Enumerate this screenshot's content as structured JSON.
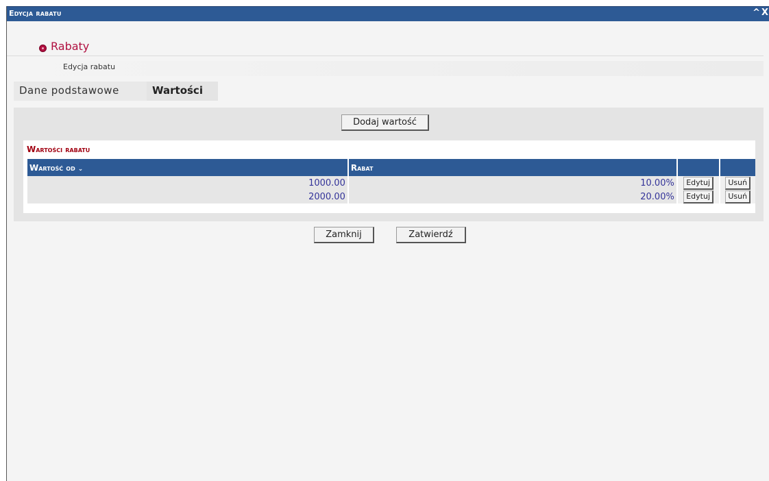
{
  "window": {
    "title": "Edycja rabatu",
    "minimize_glyph": "^",
    "close_glyph": "X"
  },
  "header": {
    "section_title": "Rabaty",
    "subtitle": "Edycja rabatu"
  },
  "tabs": [
    {
      "label": "Dane podstawowe",
      "active": false
    },
    {
      "label": "Wartości",
      "active": true
    }
  ],
  "panel": {
    "add_value_label": "Dodaj wartość",
    "grid_title": "Wartości rabatu",
    "columns": [
      {
        "label": "Wartość od",
        "sort_icon": "sort-desc-icon"
      },
      {
        "label": "Rabat"
      },
      {
        "label": ""
      },
      {
        "label": ""
      }
    ],
    "rows": [
      {
        "value_from": "1000.00",
        "discount": "10.00%",
        "edit_label": "Edytuj",
        "delete_label": "Usuń"
      },
      {
        "value_from": "2000.00",
        "discount": "20.00%",
        "edit_label": "Edytuj",
        "delete_label": "Usuń"
      }
    ]
  },
  "footer": {
    "close_label": "Zamknij",
    "confirm_label": "Zatwierdź"
  },
  "colors": {
    "titlebar": "#2d5a95",
    "accent_red": "#b01040",
    "grid_title_red": "#a00010",
    "cell_text": "#333399"
  }
}
